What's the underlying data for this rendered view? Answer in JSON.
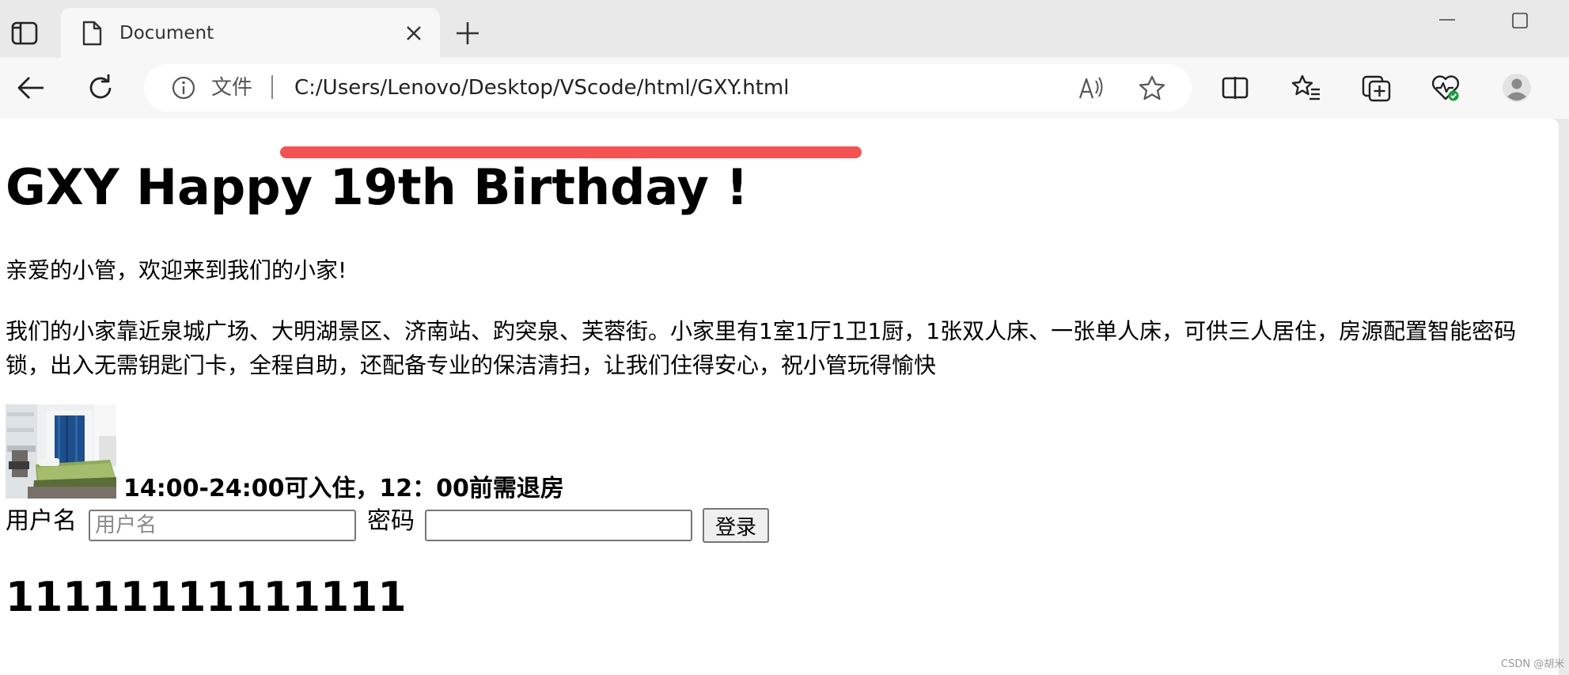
{
  "tab": {
    "title": "Document"
  },
  "address_bar": {
    "protocol_label": "文件",
    "url": "C:/Users/Lenovo/Desktop/VScode/html/GXY.html"
  },
  "page": {
    "heading": "GXY Happy 19th Birthday !",
    "greeting": "亲爱的小管，欢迎来到我们的小家!",
    "description": "我们的小家靠近泉城广场、大明湖景区、济南站、趵突泉、芙蓉街。小家里有1室1厅1卫1厨，1张双人床、一张单人床，可供三人居住，房源配置智能密码锁，出入无需钥匙门卡，全程自助，还配备专业的保洁清扫，让我们住得安心，祝小管玩得愉快",
    "checkin_note": "14:00-24:00可入住，12：00前需退房",
    "form": {
      "username_label": "用户名",
      "username_placeholder": "用户名",
      "username_value": "",
      "password_label": "密码",
      "password_value": "",
      "login_button": "登录"
    },
    "big_number": "11111111111111"
  },
  "watermark": "CSDN @胡米",
  "icons": {
    "tab_actions": "tab-actions-icon",
    "tab_page": "page-icon",
    "close": "close-icon",
    "new_tab": "plus-icon",
    "back": "back-arrow-icon",
    "refresh": "refresh-icon",
    "info": "info-icon",
    "read_aloud": "read-aloud-icon",
    "favorite": "star-icon",
    "split": "split-screen-icon",
    "favorites": "favorites-list-icon",
    "collections": "collections-icon",
    "health": "browser-essentials-icon",
    "profile": "profile-icon"
  },
  "colors": {
    "annotation_red": "#f05050",
    "health_badge": "#1a9d3e"
  }
}
